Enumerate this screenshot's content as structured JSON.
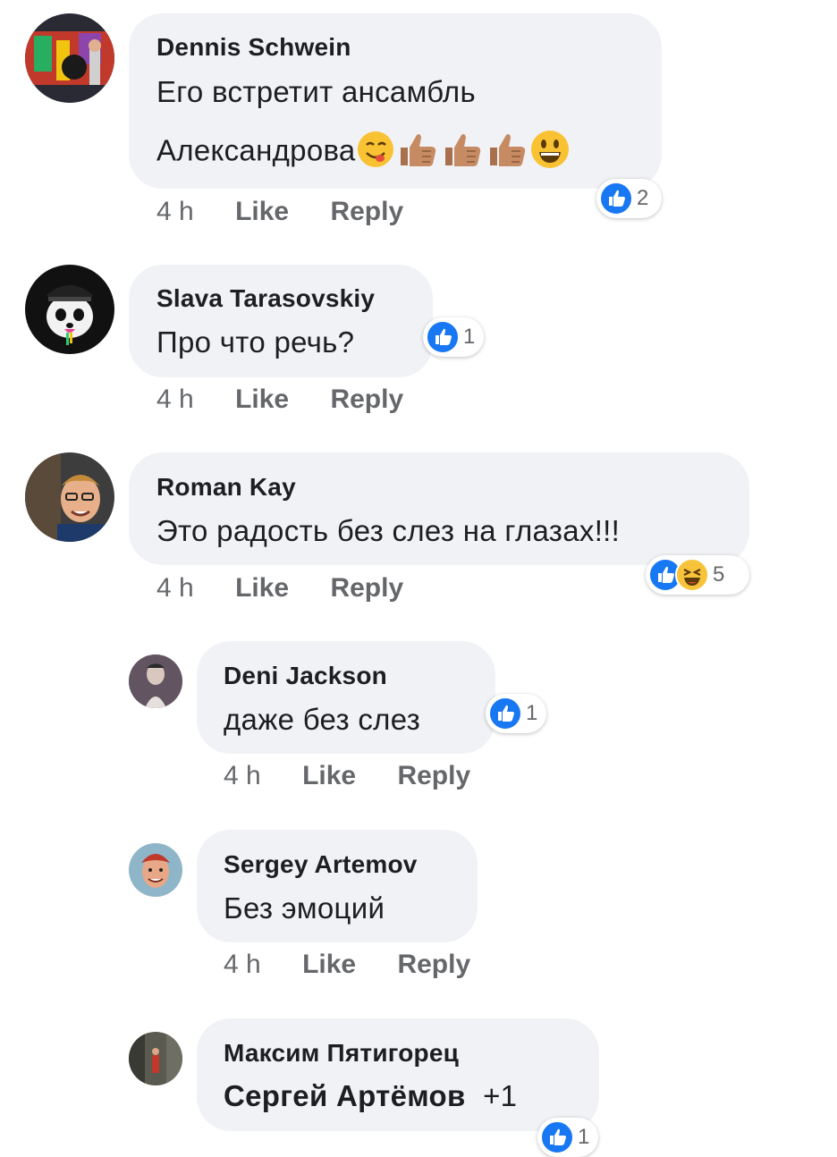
{
  "comments": [
    {
      "author": "Dennis Schwein",
      "line1": "Его встретит ансамбль",
      "line2": "Александрова",
      "emojis": [
        "yum-emoji",
        "thumbs-up-emoji",
        "thumbs-up-emoji",
        "thumbs-up-emoji",
        "smiley-emoji"
      ],
      "time": "4 h",
      "like": "Like",
      "reply": "Reply",
      "reactions": [
        "like"
      ],
      "reaction_count": "2"
    },
    {
      "author": "Slava Tarasovskiy",
      "text": "Про что речь?",
      "time": "4 h",
      "like": "Like",
      "reply": "Reply",
      "reactions": [
        "like"
      ],
      "reaction_count": "1"
    },
    {
      "author": "Roman Kay",
      "text": "Это радость без слез на глазах!!!",
      "time": "4 h",
      "like": "Like",
      "reply": "Reply",
      "reactions": [
        "like",
        "haha"
      ],
      "reaction_count": "5"
    },
    {
      "author": "Deni Jackson",
      "text": "даже без слез",
      "time": "4 h",
      "like": "Like",
      "reply": "Reply",
      "reactions": [
        "like"
      ],
      "reaction_count": "1"
    },
    {
      "author": "Sergey Artemov",
      "text": "Без эмоций",
      "time": "4 h",
      "like": "Like",
      "reply": "Reply"
    },
    {
      "author": "Максим Пятигорец",
      "mention": "Сергей Артёмов",
      "text": "+1",
      "reactions": [
        "like"
      ],
      "reaction_count": "1"
    }
  ],
  "colors": {
    "bubble": "#f0f2f5",
    "meta": "#65676b",
    "like_blue": "#1877f2",
    "haha_yellow": "#f7c33b"
  }
}
